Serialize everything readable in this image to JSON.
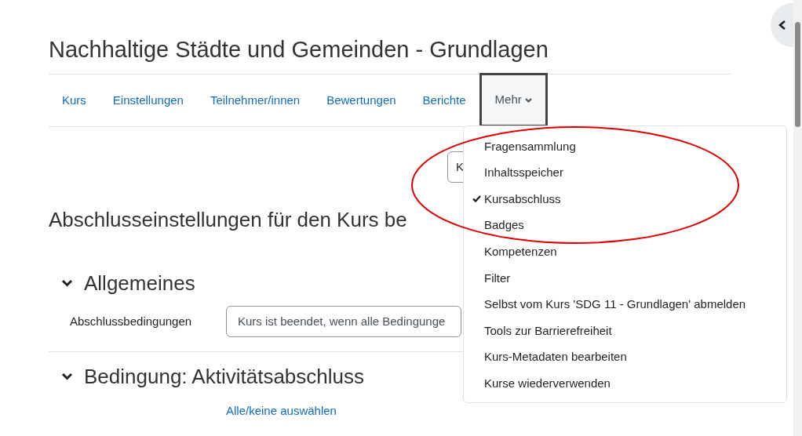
{
  "course_title": "Nachhaltige Städte und Gemeinden - Grundlagen",
  "nav_tabs": [
    {
      "label": "Kurs",
      "selected": false,
      "kind": "link"
    },
    {
      "label": "Einstellungen",
      "selected": false,
      "kind": "link"
    },
    {
      "label": "Teilnehmer/innen",
      "selected": false,
      "kind": "link"
    },
    {
      "label": "Bewertungen",
      "selected": false,
      "kind": "link"
    },
    {
      "label": "Berichte",
      "selected": false,
      "kind": "link"
    },
    {
      "label": "Mehr",
      "selected": true,
      "kind": "dropdown"
    }
  ],
  "page_select": {
    "value": "K"
  },
  "page_heading": "Abschlusseinstellungen für den Kurs be",
  "sections": [
    {
      "title": "Allgemeines",
      "expanded": true,
      "fields": [
        {
          "label": "Abschlussbedingungen",
          "value": "Kurs ist beendet, wenn alle Bedingunge"
        }
      ]
    },
    {
      "title": "Bedingung: Aktivitätsabschluss",
      "expanded": true,
      "link": "Alle/keine auswählen"
    }
  ],
  "more_menu": [
    {
      "label": "Fragensammlung",
      "checked": false
    },
    {
      "label": "Inhaltsspeicher",
      "checked": false
    },
    {
      "label": "Kursabschluss",
      "checked": true
    },
    {
      "label": "Badges",
      "checked": false
    },
    {
      "label": "Kompetenzen",
      "checked": false
    },
    {
      "label": "Filter",
      "checked": false
    },
    {
      "label": "Selbst vom Kurs 'SDG 11 - Grundlagen' abmelden",
      "checked": false
    },
    {
      "label": "Tools zur Barrierefreiheit",
      "checked": false
    },
    {
      "label": "Kurs-Metadaten bearbeiten",
      "checked": false
    },
    {
      "label": "Kurse wiederverwenden",
      "checked": false
    }
  ]
}
